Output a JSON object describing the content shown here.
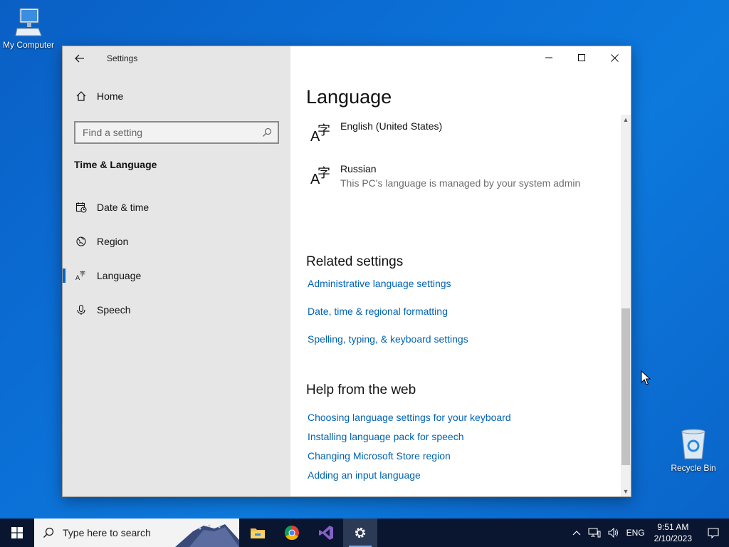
{
  "desktop": {
    "my_computer_label": "My Computer",
    "recycle_bin_label": "Recycle Bin"
  },
  "window": {
    "app_title": "Settings",
    "sidebar": {
      "home_label": "Home",
      "search_placeholder": "Find a setting",
      "section_title": "Time & Language",
      "items": [
        {
          "label": "Date & time",
          "icon": "calendar-clock-icon"
        },
        {
          "label": "Region",
          "icon": "globe-icon"
        },
        {
          "label": "Language",
          "icon": "language-icon",
          "active": true
        },
        {
          "label": "Speech",
          "icon": "microphone-icon"
        }
      ]
    },
    "content": {
      "title": "Language",
      "languages": [
        {
          "name": "English (United States)",
          "sub": ""
        },
        {
          "name": "Russian",
          "sub": "This PC's language is managed by your system admin"
        }
      ],
      "related_heading": "Related settings",
      "related_links": [
        "Administrative language settings",
        "Date, time & regional formatting",
        "Spelling, typing, & keyboard settings"
      ],
      "help_heading": "Help from the web",
      "help_links": [
        "Choosing language settings for your keyboard",
        "Installing language pack for speech",
        "Changing Microsoft Store region",
        "Adding an input language"
      ]
    }
  },
  "taskbar": {
    "search_placeholder": "Type here to search",
    "apps": [
      "file-explorer-icon",
      "chrome-icon",
      "visual-studio-icon",
      "settings-gear-icon"
    ],
    "tray": {
      "language": "ENG",
      "time": "9:51 AM",
      "date": "2/10/2023"
    }
  },
  "colors": {
    "accent": "#0067c0",
    "link": "#0063b1",
    "sidebar_bg": "#e6e6e6",
    "taskbar_bg": "#0a1630"
  }
}
